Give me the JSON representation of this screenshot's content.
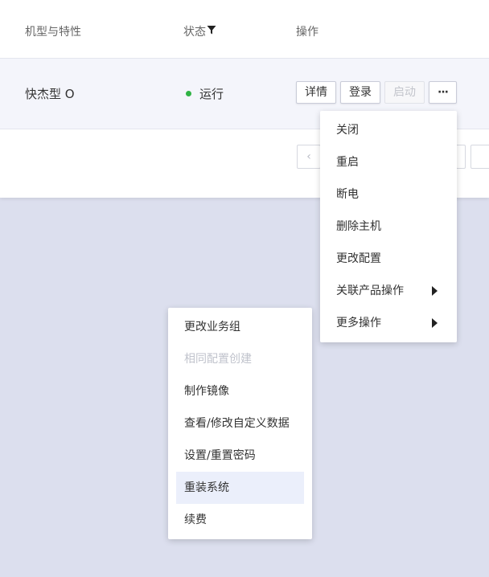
{
  "table": {
    "headers": {
      "type": "机型与特性",
      "status": "状态",
      "actions": "操作"
    },
    "rows": [
      {
        "type": "快杰型 O",
        "status": "运行",
        "buttons": {
          "detail": "详情",
          "login": "登录",
          "start": "启动",
          "more": "···"
        }
      }
    ]
  },
  "pagination": {
    "prev": "‹"
  },
  "dropdown_menu": {
    "items": [
      {
        "label": "关闭"
      },
      {
        "label": "重启"
      },
      {
        "label": "断电"
      },
      {
        "label": "删除主机"
      },
      {
        "label": "更改配置"
      },
      {
        "label": "关联产品操作",
        "has_submenu": true
      },
      {
        "label": "更多操作",
        "has_submenu": true
      }
    ]
  },
  "submenu": {
    "items": [
      {
        "label": "更改业务组"
      },
      {
        "label": "相同配置创建",
        "disabled": true
      },
      {
        "label": "制作镜像"
      },
      {
        "label": "查看/修改自定义数据"
      },
      {
        "label": "设置/重置密码"
      },
      {
        "label": "重装系统",
        "highlighted": true
      },
      {
        "label": "续费"
      }
    ]
  },
  "colors": {
    "backdrop": "#dcdfee",
    "status_running": "#2fb344",
    "highlight": "#ebeffb"
  }
}
